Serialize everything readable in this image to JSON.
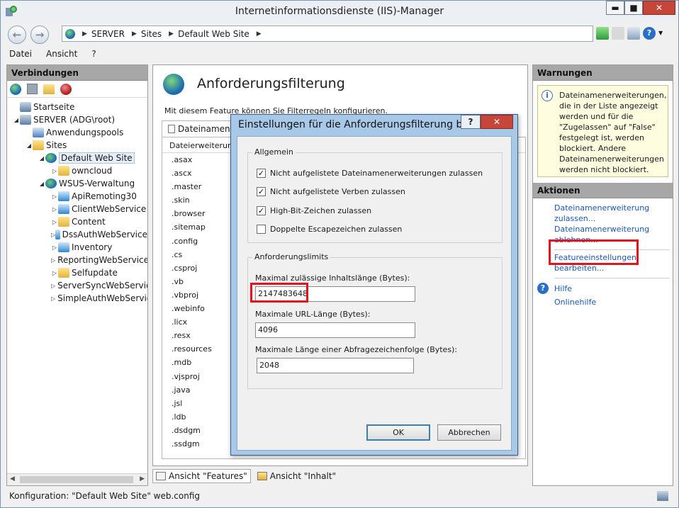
{
  "window": {
    "title": "Internetinformationsdienste (IIS)-Manager",
    "minimize": "▬",
    "maximize": "■",
    "close": "✕"
  },
  "address": {
    "crumbs": [
      "SERVER",
      "Sites",
      "Default Web Site"
    ],
    "sep": "▶",
    "help": "?"
  },
  "menu": [
    "Datei",
    "Ansicht",
    "?"
  ],
  "connections": {
    "title": "Verbindungen",
    "tree": [
      {
        "label": "Startseite",
        "icon": "home-icon"
      },
      {
        "label": "SERVER (ADG\\root)",
        "icon": "server-icon"
      },
      {
        "label": "Anwendungspools",
        "icon": "apppool-icon"
      },
      {
        "label": "Sites",
        "icon": "folder-icon"
      },
      {
        "label": "Default Web Site",
        "icon": "globe-icon"
      },
      {
        "label": "owncloud",
        "icon": "folder-icon"
      },
      {
        "label": "WSUS-Verwaltung",
        "icon": "globe-icon"
      },
      {
        "label": "ApiRemoting30",
        "icon": "app-icon"
      },
      {
        "label": "ClientWebService",
        "icon": "app-icon"
      },
      {
        "label": "Content",
        "icon": "folder-icon"
      },
      {
        "label": "DssAuthWebService",
        "icon": "app-icon"
      },
      {
        "label": "Inventory",
        "icon": "app-icon"
      },
      {
        "label": "ReportingWebService",
        "icon": "app-icon"
      },
      {
        "label": "Selfupdate",
        "icon": "folder-icon"
      },
      {
        "label": "ServerSyncWebService",
        "icon": "app-icon"
      },
      {
        "label": "SimpleAuthWebService",
        "icon": "app-icon"
      }
    ]
  },
  "feature": {
    "title": "Anforderungsfilterung",
    "description": "Mit diesem Feature können Sie Filterregeln konfigurieren.",
    "tab": "Dateinamenerweiterungen",
    "column": "Dateierweiterung",
    "extensions": [
      ".asax",
      ".ascx",
      ".master",
      ".skin",
      ".browser",
      ".sitemap",
      ".config",
      ".cs",
      ".csproj",
      ".vb",
      ".vbproj",
      ".webinfo",
      ".licx",
      ".resx",
      ".resources",
      ".mdb",
      ".vjsproj",
      ".java",
      ".jsl",
      ".ldb",
      ".dsdgm",
      ".ssdgm"
    ]
  },
  "bottom_tabs": {
    "features": "Ansicht \"Features\"",
    "content": "Ansicht \"Inhalt\""
  },
  "warnings": {
    "title": "Warnungen",
    "text": "Dateinamenerweiterungen, die in der Liste angezeigt werden und für die \"Zugelassen\" auf \"False\" festgelegt ist, werden blockiert. Andere Dateinamenerweiterungen werden nicht blockiert."
  },
  "actions": {
    "title": "Aktionen",
    "allow_line1": "Dateinamenerweiterung",
    "allow_line2": "zulassen...",
    "deny_line1": "Dateinamenerweiterung",
    "deny_line2": "ablehnen...",
    "edit_line1": "Featureeinstellungen",
    "edit_line2": "bearbeiten...",
    "help": "Hilfe",
    "online_help": "Onlinehilfe"
  },
  "status": {
    "text": "Konfiguration: \"Default Web Site\" web.config"
  },
  "dialog": {
    "title": "Einstellungen für die Anforderungsfilterung be...",
    "help": "?",
    "close": "✕",
    "group_general": "Allgemein",
    "checkboxes": [
      {
        "label": "Nicht aufgelistete Dateinamenerweiterungen zulassen",
        "checked": true
      },
      {
        "label": "Nicht aufgelistete Verben zulassen",
        "checked": true
      },
      {
        "label": "High-Bit-Zeichen zulassen",
        "checked": true
      },
      {
        "label": "Doppelte Escapezeichen zulassen",
        "checked": false
      }
    ],
    "group_limits": "Anforderungslimits",
    "max_content_label": "Maximal zulässige Inhaltslänge (Bytes):",
    "max_content_value": "2147483648",
    "max_url_label": "Maximale URL-Länge (Bytes):",
    "max_url_value": "4096",
    "max_query_label": "Maximale Länge einer Abfragezeichenfolge (Bytes):",
    "max_query_value": "2048",
    "ok": "OK",
    "cancel": "Abbrechen"
  },
  "colors": {
    "highlight": "#e3141e",
    "link": "#1a55b5",
    "dialog_frame": "#a8c8e8",
    "close_red": "#c7463a"
  }
}
